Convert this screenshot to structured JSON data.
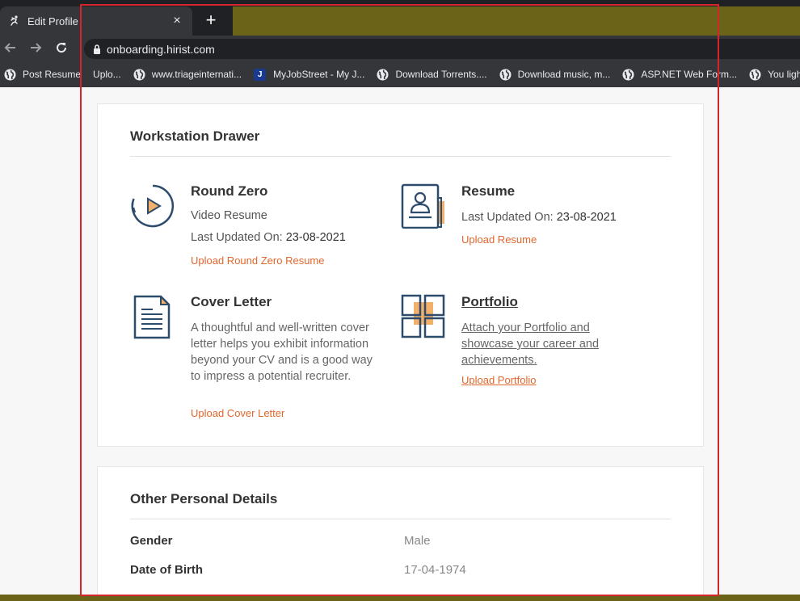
{
  "browser": {
    "tab_title": "Edit Profile",
    "tab_close": "×",
    "new_tab": "+",
    "url": "onboarding.hirist.com",
    "bookmarks": [
      {
        "label": "Post Resume",
        "icon": "globe-icon"
      },
      {
        "label": "Uplo...",
        "icon": "none"
      },
      {
        "label": "www.triageinternati...",
        "icon": "globe-icon"
      },
      {
        "label": "MyJobStreet - My J...",
        "icon": "j-icon"
      },
      {
        "label": "Download Torrents....",
        "icon": "globe-icon"
      },
      {
        "label": "Download music, m...",
        "icon": "globe-icon"
      },
      {
        "label": "ASP.NET Web Form...",
        "icon": "globe-icon"
      },
      {
        "label": "You light",
        "icon": "globe-icon"
      }
    ]
  },
  "workstation": {
    "title": "Workstation Drawer",
    "round_zero": {
      "title": "Round Zero",
      "subtitle": "Video Resume",
      "updated_label": "Last Updated On:",
      "updated_value": "23-08-2021",
      "link": "Upload Round Zero Resume"
    },
    "resume": {
      "title": "Resume",
      "updated_label": "Last Updated On:",
      "updated_value": "23-08-2021",
      "link": "Upload Resume"
    },
    "cover_letter": {
      "title": "Cover Letter",
      "description": "A thoughtful and well-written cover letter helps you exhibit information beyond your CV and is a good way to impress a potential recruiter.",
      "link": "Upload Cover Letter"
    },
    "portfolio": {
      "title": "Portfolio",
      "description": "Attach your Portfolio and showcase your career and achievements.",
      "link": "Upload Portfolio"
    }
  },
  "personal": {
    "title": "Other Personal Details",
    "rows": [
      {
        "label": "Gender",
        "value": "Male"
      },
      {
        "label": "Date of Birth",
        "value": "17-04-1974"
      }
    ]
  },
  "colors": {
    "accent": "#e2672d",
    "icon_navy": "#2d4b6b",
    "icon_orange": "#f2b06a",
    "annotation_frame": "#d4242c"
  }
}
